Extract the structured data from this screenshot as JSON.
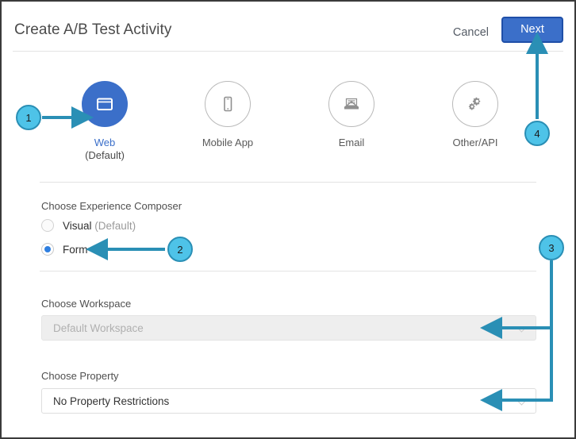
{
  "header": {
    "title": "Create A/B Test Activity",
    "cancel_label": "Cancel",
    "next_label": "Next"
  },
  "channels": [
    {
      "id": "web",
      "icon": "browser-window-icon",
      "label": "Web",
      "sublabel": "(Default)",
      "selected": true
    },
    {
      "id": "mobile",
      "icon": "mobile-phone-icon",
      "label": "Mobile App",
      "sublabel": "",
      "selected": false
    },
    {
      "id": "email",
      "icon": "envelope-icon",
      "label": "Email",
      "sublabel": "",
      "selected": false
    },
    {
      "id": "other",
      "icon": "gears-icon",
      "label": "Other/API",
      "sublabel": "",
      "selected": false
    }
  ],
  "composer": {
    "section_label": "Choose Experience Composer",
    "options": [
      {
        "id": "visual",
        "label": "Visual",
        "suffix": "(Default)",
        "selected": false
      },
      {
        "id": "form",
        "label": "Form",
        "suffix": "",
        "selected": true
      }
    ]
  },
  "workspace": {
    "section_label": "Choose Workspace",
    "value": "Default Workspace",
    "disabled": true
  },
  "property": {
    "section_label": "Choose Property",
    "value": "No Property Restrictions",
    "disabled": false
  },
  "annotations": [
    {
      "id": "1",
      "label": "1",
      "target": "web-channel-button"
    },
    {
      "id": "2",
      "label": "2",
      "target": "form-radio-option"
    },
    {
      "id": "3",
      "label": "3",
      "target": "workspace-and-property-dropdowns"
    },
    {
      "id": "4",
      "label": "4",
      "target": "next-button"
    }
  ],
  "colors": {
    "accent_blue": "#3b6fc9",
    "callout_cyan": "#4ec3e8",
    "callout_border": "#2a8fb5",
    "arrow_teal": "#2a8fb5",
    "radio_blue": "#2f7fe0"
  }
}
